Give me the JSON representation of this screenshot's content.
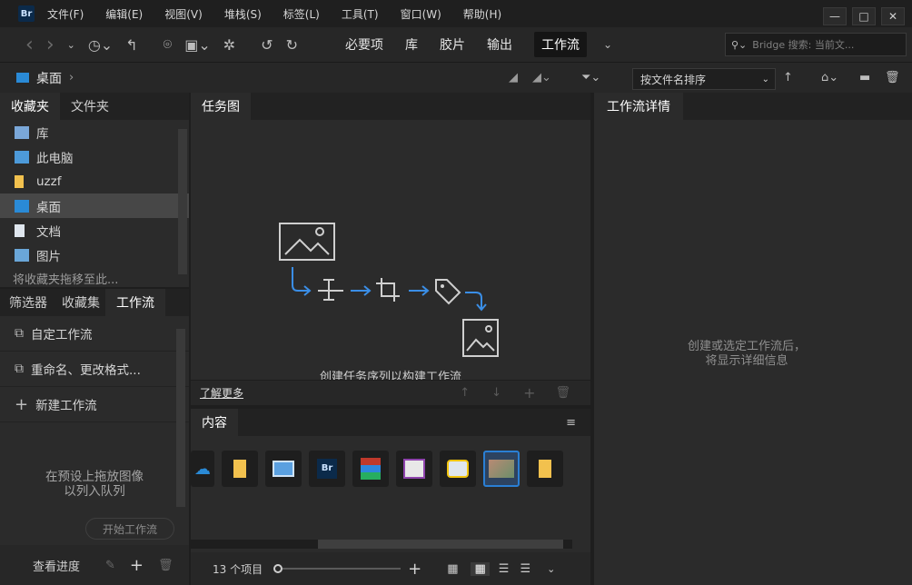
{
  "app": {
    "logo": "Br"
  },
  "menu": [
    "文件(F)",
    "编辑(E)",
    "视图(V)",
    "堆栈(S)",
    "标签(L)",
    "工具(T)",
    "窗口(W)",
    "帮助(H)"
  ],
  "window_controls": {
    "minimize": "—",
    "restore": "□",
    "close": "✕"
  },
  "toolbar": {
    "workspaces": [
      "必要项",
      "库",
      "胶片",
      "输出",
      "工作流"
    ],
    "active_workspace": "工作流",
    "search_placeholder": "Bridge 搜索: 当前文..."
  },
  "path": {
    "current": "桌面",
    "arrow": "›"
  },
  "sort": {
    "label": "按文件名排序"
  },
  "favorites_panel": {
    "tabs": [
      "收藏夹",
      "文件夹"
    ],
    "items": [
      {
        "label": "库",
        "icon": "library-icon"
      },
      {
        "label": "此电脑",
        "icon": "computer-icon"
      },
      {
        "label": "uzzf",
        "icon": "folder-icon"
      },
      {
        "label": "桌面",
        "icon": "desktop-icon",
        "selected": true
      },
      {
        "label": "文档",
        "icon": "document-icon"
      },
      {
        "label": "图片",
        "icon": "pictures-icon"
      }
    ],
    "hint": "将收藏夹拖移至此..."
  },
  "workflow_panel": {
    "tabs": [
      "筛选器",
      "收藏集",
      "工作流"
    ],
    "items": [
      {
        "label": "自定工作流"
      },
      {
        "label": "重命名、更改格式..."
      }
    ],
    "new_label": "新建工作流",
    "drop_hint_1": "在预设上拖放图像",
    "drop_hint_2": "以列入队列",
    "start_button": "开始工作流",
    "progress_label": "查看进度"
  },
  "task_panel": {
    "tab": "任务图",
    "caption": "创建任务序列以构建工作流",
    "learn_more": "了解更多"
  },
  "details_panel": {
    "tab": "工作流详情",
    "hint_1": "创建或选定工作流后，",
    "hint_2": "将显示详细信息"
  },
  "content_panel": {
    "tab": "内容",
    "item_count": "13 个项目",
    "thumbnails": [
      "onedrive-icon",
      "folder-icon",
      "control-panel-icon",
      "bridge-shortcut-icon",
      "winrar-icon",
      "paint-icon",
      "camera-tool-icon",
      "photo-icon",
      "folder-shortcut-icon"
    ]
  },
  "colors": {
    "accent": "#2a7fd4",
    "arrow_blue": "#3a8ee6",
    "folder_yellow": "#f2c14e"
  }
}
